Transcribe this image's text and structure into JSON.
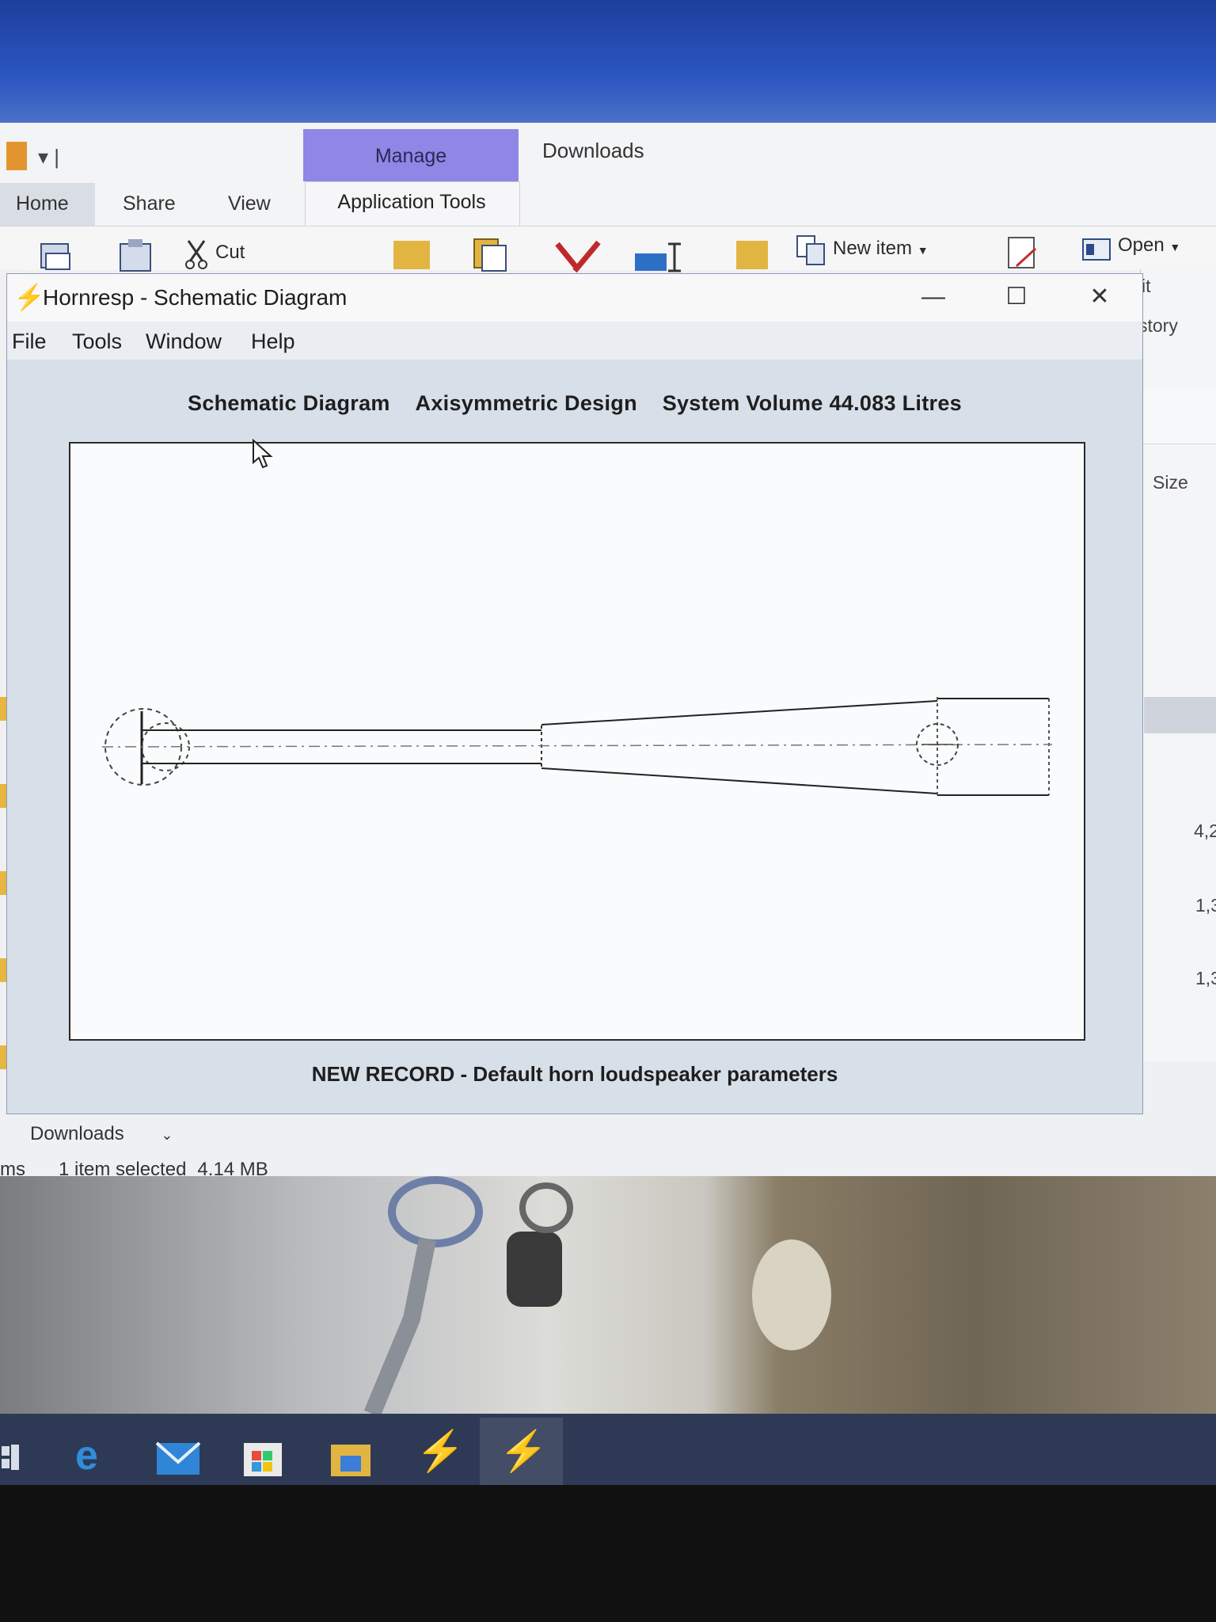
{
  "explorer": {
    "context_tab": "Manage",
    "context_group": "Application Tools",
    "title": "Downloads",
    "tabs": [
      "Home",
      "Share",
      "View"
    ],
    "ribbon": {
      "cut": "Cut",
      "new_item": "New item",
      "open": "Open"
    },
    "right_pane": {
      "partial_edit": "it",
      "partial_history": "story",
      "size_header": "Size",
      "sizes": [
        "4,2",
        "1,3",
        "1,3"
      ]
    },
    "status": {
      "folder": "Downloads",
      "items_partial": "ms",
      "selected": "1 item selected",
      "size": "4.14 MB"
    }
  },
  "hornresp": {
    "title": "Hornresp - Schematic Diagram",
    "menu": [
      "File",
      "Tools",
      "Window",
      "Help"
    ],
    "heading": [
      "Schematic Diagram",
      "Axisymmetric Design",
      "System Volume 44.083 Litres"
    ],
    "record": "NEW RECORD - Default horn loudspeaker parameters",
    "window_controls": {
      "minimize": "—",
      "maximize": "☐",
      "close": "✕"
    }
  },
  "colors": {
    "accent_manage": "#8f86e6",
    "taskbar": "#2e3a55",
    "window_bg": "#d7dfe9"
  },
  "taskbar": {
    "icons": [
      "task-view-icon",
      "edge-icon",
      "mail-icon",
      "store-icon",
      "file-explorer-icon",
      "hornresp-icon",
      "hornresp-icon"
    ]
  }
}
